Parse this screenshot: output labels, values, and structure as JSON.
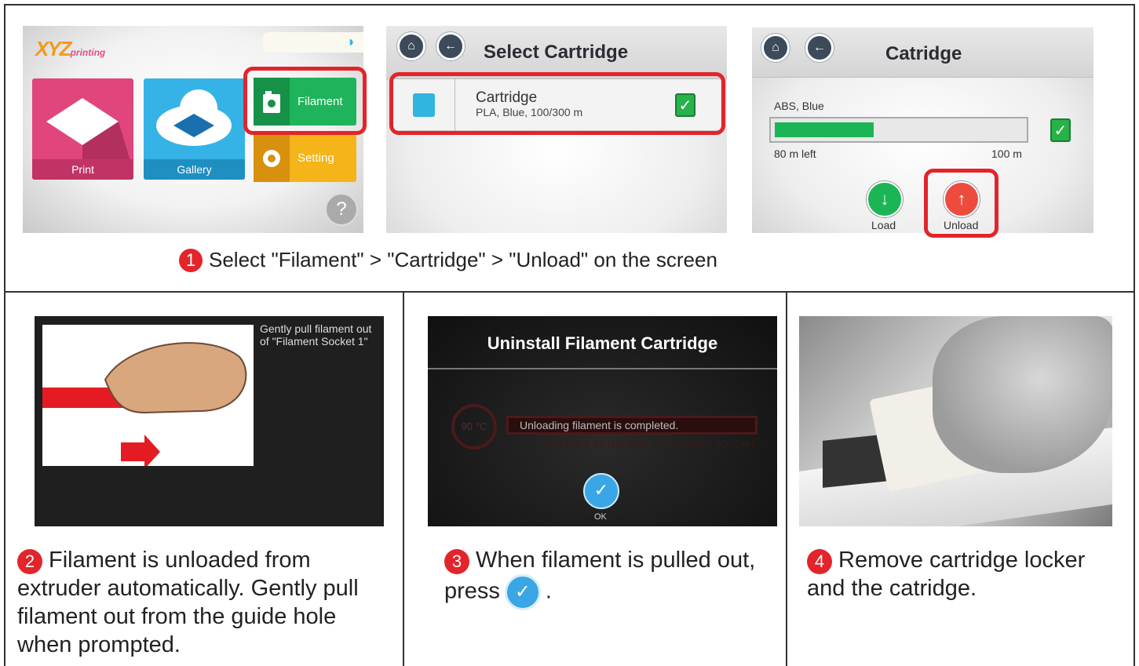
{
  "home": {
    "logo": "XYZ",
    "logo_sub": "printing",
    "tiles": {
      "print": "Print",
      "gallery": "Gallery",
      "filament": "Filament",
      "setting": "Setting"
    },
    "help": "?"
  },
  "select_cartridge": {
    "title": "Select Cartridge",
    "cartridge_name": "Cartridge",
    "cartridge_detail": "PLA, Blue, 100/300 m"
  },
  "catridge": {
    "title": "Catridge",
    "material": "ABS, Blue",
    "remaining_label": "80 m  left",
    "max_label": "100 m",
    "fill_fraction": 0.4,
    "load_label": "Load",
    "unload_label": "Unload"
  },
  "step1": {
    "number": "1",
    "text": "Select \"Filament\" > \"Cartridge\" > \"Unload\" on the screen"
  },
  "pull_screen": {
    "text": "Gently pull filament out of \"Filament Socket 1\""
  },
  "uninstall_screen": {
    "title": "Uninstall Filament Cartridge",
    "temp": "90 °C",
    "message": "Unloading filament is completed.",
    "warning": "Print Bed is EXTREMELY HOT. DO NOT TOUCH!!",
    "ok_label": "OK"
  },
  "step2": {
    "number": "2",
    "text": "Filament is unloaded from extruder automatically. Gently pull filament out from the guide hole when prompted."
  },
  "step3": {
    "number": "3",
    "text_before": "When filament is pulled out, press",
    "text_after": "."
  },
  "step4": {
    "number": "4",
    "text": "Remove cartridge locker and the catridge."
  },
  "colors": {
    "highlight": "#e3242b",
    "filament_green": "#1fb35b",
    "ok_blue": "#3aa6e6"
  },
  "icons": [
    "home-icon",
    "back-icon",
    "wifi-icon",
    "check-icon",
    "load-icon",
    "unload-icon",
    "gear-icon",
    "help-icon"
  ]
}
